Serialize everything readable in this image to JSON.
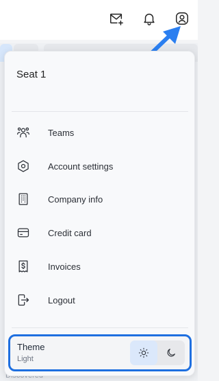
{
  "topbar": {
    "icons": [
      "mail-plus-icon",
      "bell-icon",
      "user-circle-icon"
    ]
  },
  "background": {
    "bottom_text": "Discovered"
  },
  "menu": {
    "seat_title": "Seat 1",
    "items": [
      {
        "label": "Teams",
        "icon": "users-icon"
      },
      {
        "label": "Account settings",
        "icon": "hexagon-settings-icon"
      },
      {
        "label": "Company info",
        "icon": "building-icon"
      },
      {
        "label": "Credit card",
        "icon": "credit-card-icon"
      },
      {
        "label": "Invoices",
        "icon": "invoice-dollar-icon"
      },
      {
        "label": "Logout",
        "icon": "logout-icon"
      }
    ]
  },
  "theme": {
    "title": "Theme",
    "current": "Light",
    "options": [
      "sun-icon",
      "moon-icon"
    ]
  },
  "colors": {
    "accent": "#1e6fe0",
    "arrow": "#2b7ff0"
  }
}
